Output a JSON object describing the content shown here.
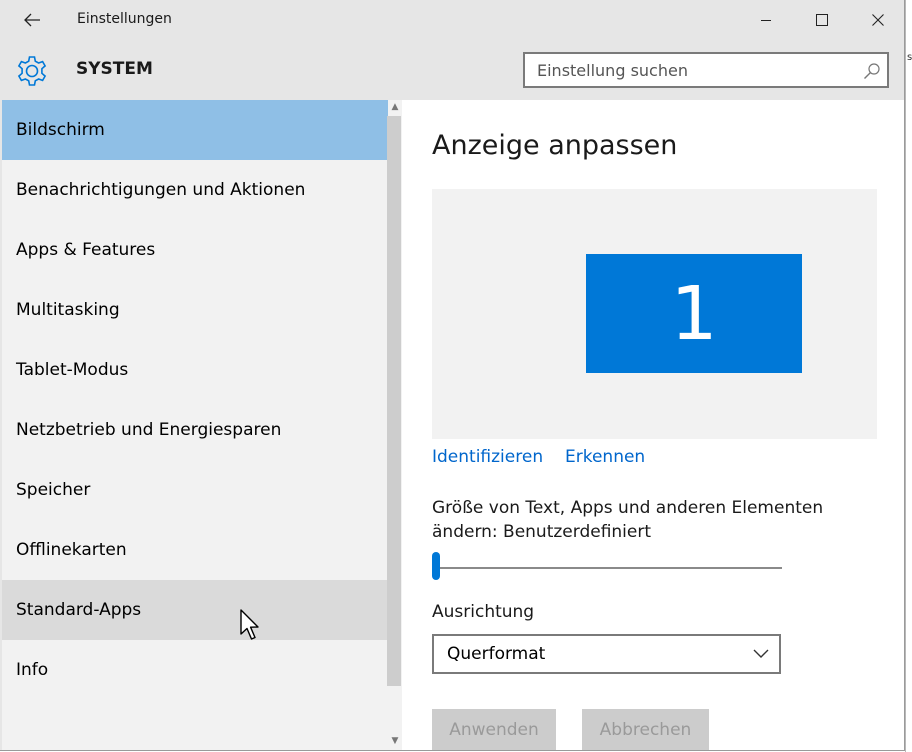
{
  "window": {
    "title": "Einstellungen",
    "back_icon": "back-arrow-icon",
    "minimize_icon": "minimize-icon",
    "maximize_icon": "maximize-icon",
    "close_icon": "close-icon"
  },
  "header": {
    "icon": "gear-icon",
    "title": "SYSTEM",
    "search_placeholder": "Einstellung suchen",
    "search_icon": "search-icon"
  },
  "sidebar": {
    "items": [
      {
        "label": "Bildschirm",
        "state": "selected"
      },
      {
        "label": "Benachrichtigungen und Aktionen",
        "state": "normal"
      },
      {
        "label": "Apps & Features",
        "state": "normal"
      },
      {
        "label": "Multitasking",
        "state": "normal"
      },
      {
        "label": "Tablet-Modus",
        "state": "normal"
      },
      {
        "label": "Netzbetrieb und Energiesparen",
        "state": "normal"
      },
      {
        "label": "Speicher",
        "state": "normal"
      },
      {
        "label": "Offlinekarten",
        "state": "normal"
      },
      {
        "label": "Standard-Apps",
        "state": "hover"
      },
      {
        "label": "Info",
        "state": "normal"
      }
    ]
  },
  "main": {
    "title": "Anzeige anpassen",
    "monitor_number": "1",
    "identify_link": "Identifizieren",
    "detect_link": "Erkennen",
    "scale_label": "Größe von Text, Apps und anderen Elementen ändern: Benutzerdefiniert",
    "scale_slider_value": 0,
    "orientation_label": "Ausrichtung",
    "orientation_value": "Querformat",
    "apply_button": "Anwenden",
    "cancel_button": "Abbrechen"
  },
  "colors": {
    "accent": "#0078d7",
    "selected_item": "#8fbfe6",
    "hover_item": "#dadada",
    "link": "#0066cc",
    "disabled_button": "#cccccc"
  }
}
